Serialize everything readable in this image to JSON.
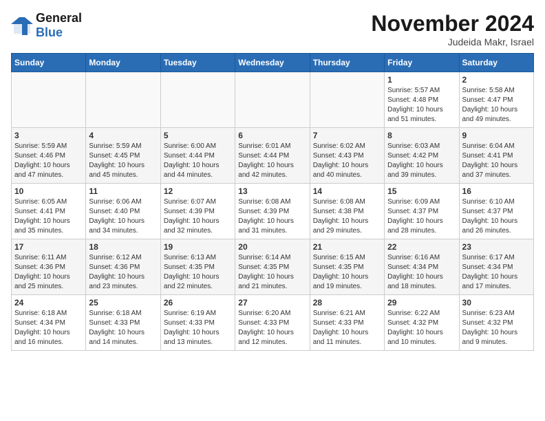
{
  "logo": {
    "text_general": "General",
    "text_blue": "Blue"
  },
  "header": {
    "month_title": "November 2024",
    "location": "Judeida Makr, Israel"
  },
  "weekdays": [
    "Sunday",
    "Monday",
    "Tuesday",
    "Wednesday",
    "Thursday",
    "Friday",
    "Saturday"
  ],
  "weeks": [
    [
      {
        "day": "",
        "info": ""
      },
      {
        "day": "",
        "info": ""
      },
      {
        "day": "",
        "info": ""
      },
      {
        "day": "",
        "info": ""
      },
      {
        "day": "",
        "info": ""
      },
      {
        "day": "1",
        "info": "Sunrise: 5:57 AM\nSunset: 4:48 PM\nDaylight: 10 hours\nand 51 minutes."
      },
      {
        "day": "2",
        "info": "Sunrise: 5:58 AM\nSunset: 4:47 PM\nDaylight: 10 hours\nand 49 minutes."
      }
    ],
    [
      {
        "day": "3",
        "info": "Sunrise: 5:59 AM\nSunset: 4:46 PM\nDaylight: 10 hours\nand 47 minutes."
      },
      {
        "day": "4",
        "info": "Sunrise: 5:59 AM\nSunset: 4:45 PM\nDaylight: 10 hours\nand 45 minutes."
      },
      {
        "day": "5",
        "info": "Sunrise: 6:00 AM\nSunset: 4:44 PM\nDaylight: 10 hours\nand 44 minutes."
      },
      {
        "day": "6",
        "info": "Sunrise: 6:01 AM\nSunset: 4:44 PM\nDaylight: 10 hours\nand 42 minutes."
      },
      {
        "day": "7",
        "info": "Sunrise: 6:02 AM\nSunset: 4:43 PM\nDaylight: 10 hours\nand 40 minutes."
      },
      {
        "day": "8",
        "info": "Sunrise: 6:03 AM\nSunset: 4:42 PM\nDaylight: 10 hours\nand 39 minutes."
      },
      {
        "day": "9",
        "info": "Sunrise: 6:04 AM\nSunset: 4:41 PM\nDaylight: 10 hours\nand 37 minutes."
      }
    ],
    [
      {
        "day": "10",
        "info": "Sunrise: 6:05 AM\nSunset: 4:41 PM\nDaylight: 10 hours\nand 35 minutes."
      },
      {
        "day": "11",
        "info": "Sunrise: 6:06 AM\nSunset: 4:40 PM\nDaylight: 10 hours\nand 34 minutes."
      },
      {
        "day": "12",
        "info": "Sunrise: 6:07 AM\nSunset: 4:39 PM\nDaylight: 10 hours\nand 32 minutes."
      },
      {
        "day": "13",
        "info": "Sunrise: 6:08 AM\nSunset: 4:39 PM\nDaylight: 10 hours\nand 31 minutes."
      },
      {
        "day": "14",
        "info": "Sunrise: 6:08 AM\nSunset: 4:38 PM\nDaylight: 10 hours\nand 29 minutes."
      },
      {
        "day": "15",
        "info": "Sunrise: 6:09 AM\nSunset: 4:37 PM\nDaylight: 10 hours\nand 28 minutes."
      },
      {
        "day": "16",
        "info": "Sunrise: 6:10 AM\nSunset: 4:37 PM\nDaylight: 10 hours\nand 26 minutes."
      }
    ],
    [
      {
        "day": "17",
        "info": "Sunrise: 6:11 AM\nSunset: 4:36 PM\nDaylight: 10 hours\nand 25 minutes."
      },
      {
        "day": "18",
        "info": "Sunrise: 6:12 AM\nSunset: 4:36 PM\nDaylight: 10 hours\nand 23 minutes."
      },
      {
        "day": "19",
        "info": "Sunrise: 6:13 AM\nSunset: 4:35 PM\nDaylight: 10 hours\nand 22 minutes."
      },
      {
        "day": "20",
        "info": "Sunrise: 6:14 AM\nSunset: 4:35 PM\nDaylight: 10 hours\nand 21 minutes."
      },
      {
        "day": "21",
        "info": "Sunrise: 6:15 AM\nSunset: 4:35 PM\nDaylight: 10 hours\nand 19 minutes."
      },
      {
        "day": "22",
        "info": "Sunrise: 6:16 AM\nSunset: 4:34 PM\nDaylight: 10 hours\nand 18 minutes."
      },
      {
        "day": "23",
        "info": "Sunrise: 6:17 AM\nSunset: 4:34 PM\nDaylight: 10 hours\nand 17 minutes."
      }
    ],
    [
      {
        "day": "24",
        "info": "Sunrise: 6:18 AM\nSunset: 4:34 PM\nDaylight: 10 hours\nand 16 minutes."
      },
      {
        "day": "25",
        "info": "Sunrise: 6:18 AM\nSunset: 4:33 PM\nDaylight: 10 hours\nand 14 minutes."
      },
      {
        "day": "26",
        "info": "Sunrise: 6:19 AM\nSunset: 4:33 PM\nDaylight: 10 hours\nand 13 minutes."
      },
      {
        "day": "27",
        "info": "Sunrise: 6:20 AM\nSunset: 4:33 PM\nDaylight: 10 hours\nand 12 minutes."
      },
      {
        "day": "28",
        "info": "Sunrise: 6:21 AM\nSunset: 4:33 PM\nDaylight: 10 hours\nand 11 minutes."
      },
      {
        "day": "29",
        "info": "Sunrise: 6:22 AM\nSunset: 4:32 PM\nDaylight: 10 hours\nand 10 minutes."
      },
      {
        "day": "30",
        "info": "Sunrise: 6:23 AM\nSunset: 4:32 PM\nDaylight: 10 hours\nand 9 minutes."
      }
    ]
  ]
}
